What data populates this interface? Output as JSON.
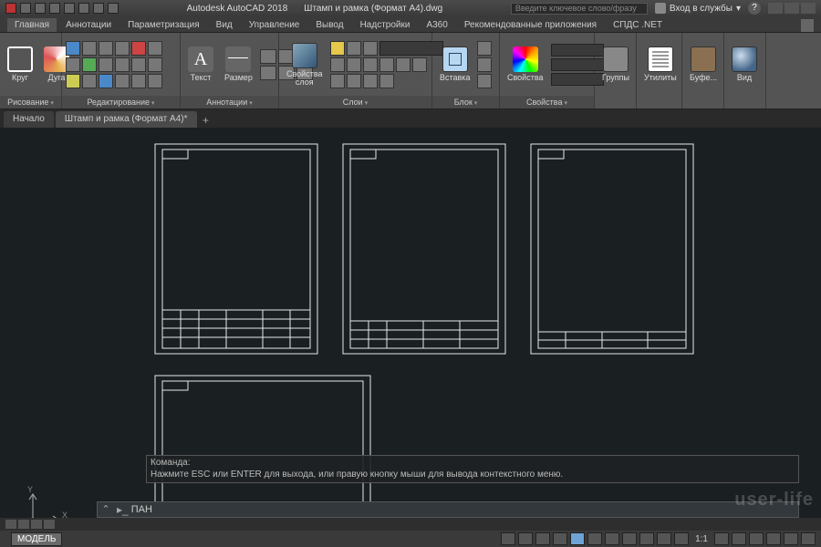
{
  "title": {
    "app": "Autodesk AutoCAD 2018",
    "file": "Штамп и рамка (Формат A4).dwg"
  },
  "search_placeholder": "Введите ключевое слово/фразу",
  "login_label": "Вход в службы",
  "help_symbol": "?",
  "ribbon_tabs": [
    "Главная",
    "Аннотации",
    "Параметризация",
    "Вид",
    "Управление",
    "Вывод",
    "Надстройки",
    "A360",
    "Рекомендованные приложения",
    "СПДС .NET"
  ],
  "panels": {
    "draw": {
      "label": "Рисование",
      "circle": "Круг",
      "arc": "Дуга"
    },
    "modify": {
      "label": "Редактирование"
    },
    "anno": {
      "label": "Аннотации",
      "text": "Текст",
      "dim": "Размер"
    },
    "layers": {
      "label": "Слои",
      "props": "Свойства\nслоя"
    },
    "block": {
      "label": "Блок",
      "insert": "Вставка"
    },
    "props": {
      "label": "Свойства",
      "wheel": "Свойства"
    },
    "groups": {
      "label": "Группы"
    },
    "util": {
      "label": "Утилиты"
    },
    "clip": {
      "label": "Буфе..."
    },
    "view": {
      "label": "Вид"
    }
  },
  "file_tabs": [
    "Начало",
    "Штамп и рамка (Формат A4)*"
  ],
  "ucs": {
    "x": "X",
    "y": "Y"
  },
  "cmd": {
    "line1": "Команда:",
    "line2": "Нажмите ESC или ENTER для выхода, или правую кнопку мыши для вывода контекстного меню.",
    "prompt": "ПАН"
  },
  "status": {
    "model": "МОДЕЛЬ",
    "scale": "1:1"
  },
  "watermark": "user-life"
}
